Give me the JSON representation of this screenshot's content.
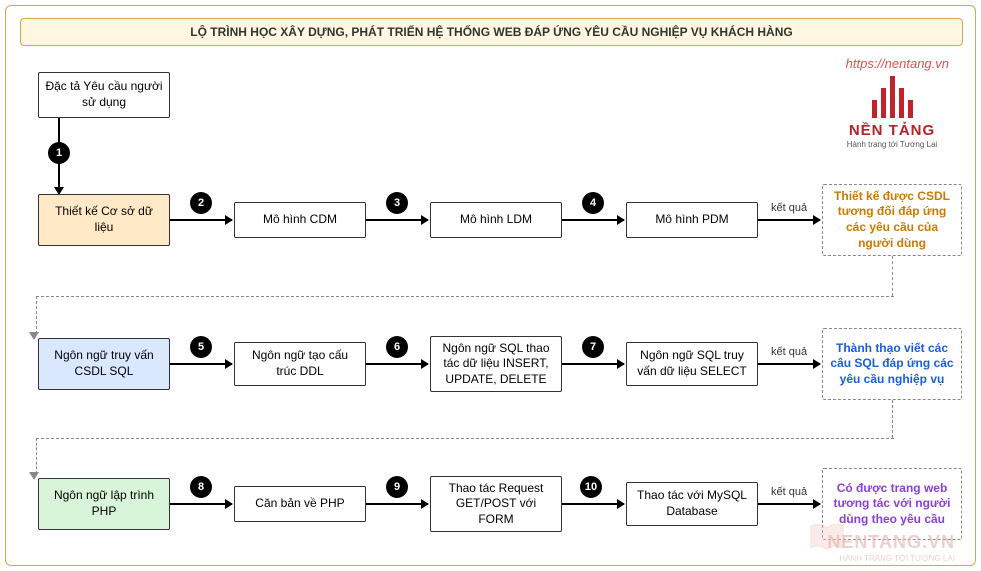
{
  "title": "LỘ TRÌNH HỌC XÂY DỰNG, PHÁT TRIỂN HỆ THỐNG WEB ĐÁP ỨNG YÊU CẦU NGHIỆP VỤ KHÁCH HÀNG",
  "url": "https://nentang.vn",
  "logo": {
    "name": "NỀN TẢNG",
    "tagline": "Hành trang tới Tương Lai"
  },
  "nodes": {
    "req": "Đặc tả Yêu cầu người sử dụng",
    "db_design": "Thiết kế Cơ sở dữ liệu",
    "cdm": "Mô hình CDM",
    "ldm": "Mô hình LDM",
    "pdm": "Mô hình PDM",
    "result1": "Thiết kế được CSDL tương đối đáp ứng các yêu cầu của người dùng",
    "sql_lang": "Ngôn ngữ truy vấn CSDL SQL",
    "ddl": "Ngôn ngữ tạo cấu trúc DDL",
    "dml": "Ngôn ngữ SQL thao tác dữ liệu INSERT, UPDATE, DELETE",
    "select": "Ngôn ngữ SQL truy vấn dữ liệu SELECT",
    "result2": "Thành thạo viết các câu SQL đáp ứng các yêu cầu nghiệp vụ",
    "php_lang": "Ngôn ngữ lập trình PHP",
    "php_basic": "Căn bản về PHP",
    "form": "Thao tác Request GET/POST với FORM",
    "mysql": "Thao tác với MySQL Database",
    "result3": "Có được trang web tương tác với người dùng theo yêu cầu"
  },
  "steps": {
    "s1": "1",
    "s2": "2",
    "s3": "3",
    "s4": "4",
    "s5": "5",
    "s6": "6",
    "s7": "7",
    "s8": "8",
    "s9": "9",
    "s10": "10"
  },
  "edge_label": "kết quả",
  "watermark": {
    "text": "NENTANG.VN",
    "sub": "HÀNH TRANG TỚI TƯƠNG LAI"
  }
}
